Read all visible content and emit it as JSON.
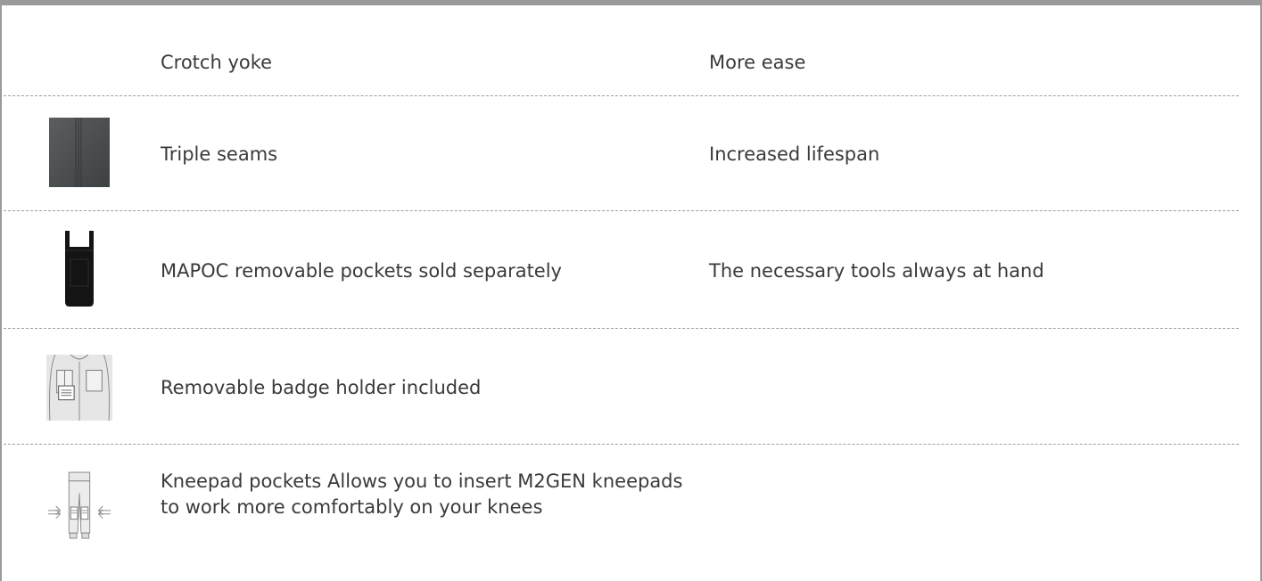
{
  "rows": [
    {
      "feature": "Crotch yoke",
      "benefit": "More ease",
      "icon": "none"
    },
    {
      "feature": "Triple seams",
      "benefit": "Increased lifespan",
      "icon": "fabric-swatch-icon"
    },
    {
      "feature": "MAPOC removable pockets sold separately",
      "benefit": "The necessary tools always at hand",
      "icon": "removable-pocket-icon"
    },
    {
      "feature": "Removable badge holder included",
      "benefit": "",
      "icon": "badge-holder-icon"
    },
    {
      "feature": "Kneepad pockets Allows you to insert M2GEN kneepads to work more comfortably on your knees",
      "benefit": "",
      "icon": "kneepad-pockets-icon"
    }
  ],
  "colors": {
    "border": "#9a9a9a",
    "text": "#3a3a3a",
    "divider": "#9e9e9e"
  }
}
